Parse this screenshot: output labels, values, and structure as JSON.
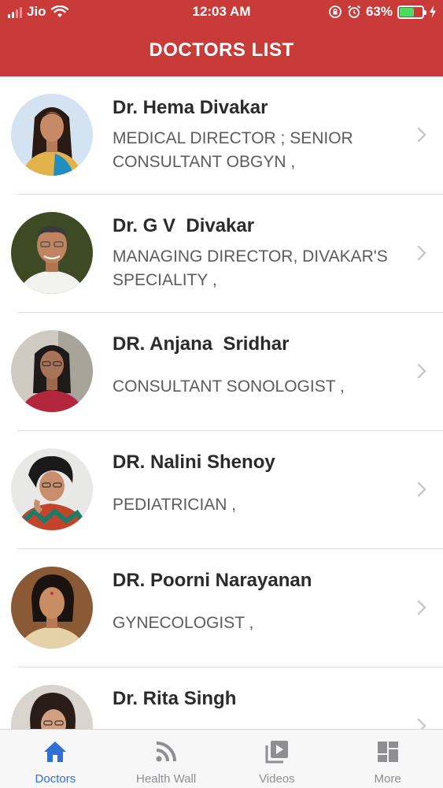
{
  "status_bar": {
    "carrier": "Jio",
    "time": "12:03 AM",
    "battery_percent": "63%",
    "battery_level": 0.63
  },
  "header": {
    "title": "DOCTORS LIST",
    "color": "#c83b39"
  },
  "doctors": [
    {
      "name": "Dr. Hema Divakar",
      "title": "MEDICAL DIRECTOR ; SENIOR CONSULTANT OBGYN ,"
    },
    {
      "name": "Dr. G V  Divakar",
      "title": "MANAGING DIRECTOR, DIVAKAR'S SPECIALITY ,"
    },
    {
      "name": "DR. Anjana  Sridhar",
      "title": "CONSULTANT SONOLOGIST ,"
    },
    {
      "name": "DR. Nalini Shenoy",
      "title": "PEDIATRICIAN ,"
    },
    {
      "name": "DR. Poorni Narayanan",
      "title": "GYNECOLOGIST ,"
    },
    {
      "name": "Dr. Rita Singh",
      "title": ""
    }
  ],
  "tab_bar": {
    "active_color": "#2f6fd6",
    "tabs": [
      {
        "label": "Doctors",
        "icon": "home-icon",
        "active": true
      },
      {
        "label": "Health Wall",
        "icon": "rss-icon",
        "active": false
      },
      {
        "label": "Videos",
        "icon": "video-library-icon",
        "active": false
      },
      {
        "label": "More",
        "icon": "grid-icon",
        "active": false
      }
    ]
  }
}
